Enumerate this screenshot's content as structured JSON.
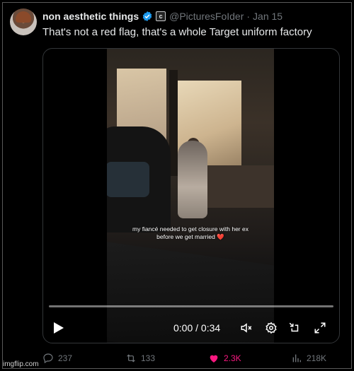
{
  "tweet": {
    "display_name": "non aesthetic things",
    "label_badge": "c",
    "handle": "@PicturesFoIder",
    "separator": "·",
    "date": "Jan 15",
    "text": "That's not a red flag, that's a whole Target uniform factory"
  },
  "video": {
    "caption_line1": "my fiancé needed to get closure with her ex",
    "caption_line2": "before we get married",
    "caption_emoji": "❤️",
    "time": "0:00 / 0:34",
    "progress": 0
  },
  "actions": {
    "replies": "237",
    "retweets": "133",
    "likes": "2.3K",
    "views": "218K"
  },
  "watermark": "imgflip.com",
  "colors": {
    "background": "#000000",
    "text": "#e7e9ea",
    "muted": "#71767b",
    "verified": "#1d9bf0",
    "like": "#f91880"
  },
  "icons": [
    "verified-badge-icon",
    "play-icon",
    "volume-icon",
    "settings-icon",
    "minimize-icon",
    "fullscreen-icon",
    "reply-icon",
    "retweet-icon",
    "like-icon",
    "views-icon"
  ]
}
